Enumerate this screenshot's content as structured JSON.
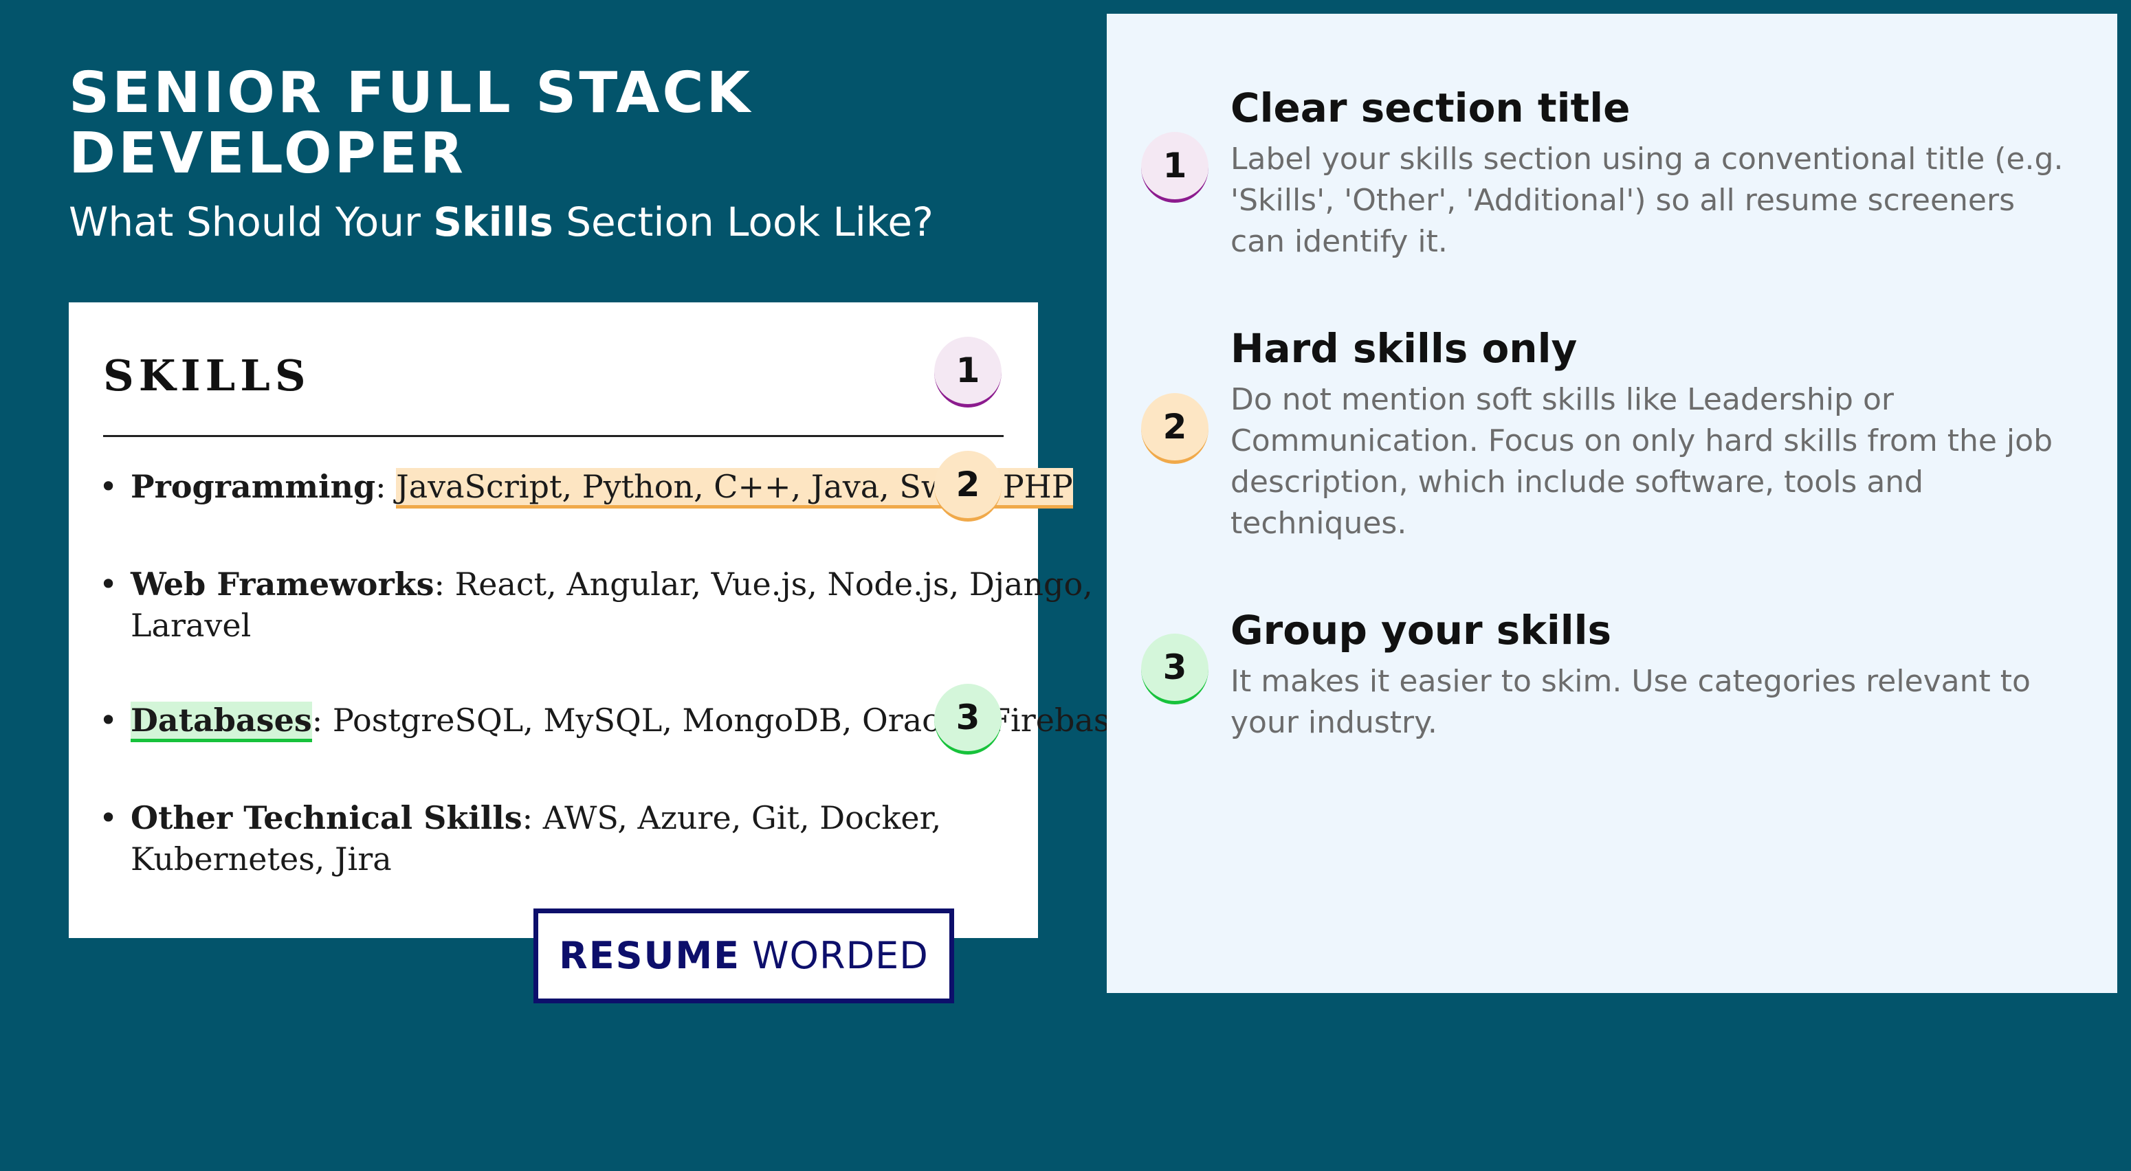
{
  "header": {
    "title_line1": "SENIOR FULL STACK",
    "title_line2": "DEVELOPER",
    "subtitle_before": "What Should Your ",
    "subtitle_bold": "Skills",
    "subtitle_after": " Section Look Like?"
  },
  "resume": {
    "section_title": "SKILLS",
    "items": [
      {
        "category": "Programming",
        "separator": ": ",
        "value": "JavaScript, Python, C++, Java, Swift, PHP"
      },
      {
        "category": "Web Frameworks",
        "separator": ": ",
        "value": "React, Angular, Vue.js, Node.js, Django,",
        "value_line2": "Laravel"
      },
      {
        "category": "Databases",
        "separator": ": ",
        "value": "PostgreSQL, MySQL, MongoDB, Oracle, Firebase"
      },
      {
        "category": "Other Technical Skills",
        "separator": ": ",
        "value": "AWS, Azure, Git, Docker,",
        "value_line2": "Kubernetes, Jira"
      }
    ],
    "bullet": "•"
  },
  "badges": [
    "1",
    "2",
    "3"
  ],
  "logo": {
    "word1": "RESUME",
    "word2": "WORDED"
  },
  "tips": [
    {
      "title": "Clear section title",
      "description": "Label your skills section using a conventional title (e.g. 'Skills', 'Other', 'Additional') so all resume screeners can identify it."
    },
    {
      "title": "Hard skills only",
      "description": "Do not mention soft skills like Leadership or Communication. Focus on only hard skills from the job description, which include software, tools and techniques."
    },
    {
      "title": "Group your skills",
      "description": "It makes it easier to skim. Use categories relevant to your industry."
    }
  ],
  "colors": {
    "background": "#03546b",
    "panel": "#eef6fd",
    "badge1_accent": "#8c1b8e",
    "badge2_accent": "#f0a94a",
    "badge3_accent": "#17c23b",
    "logo": "#0d0f6b"
  }
}
